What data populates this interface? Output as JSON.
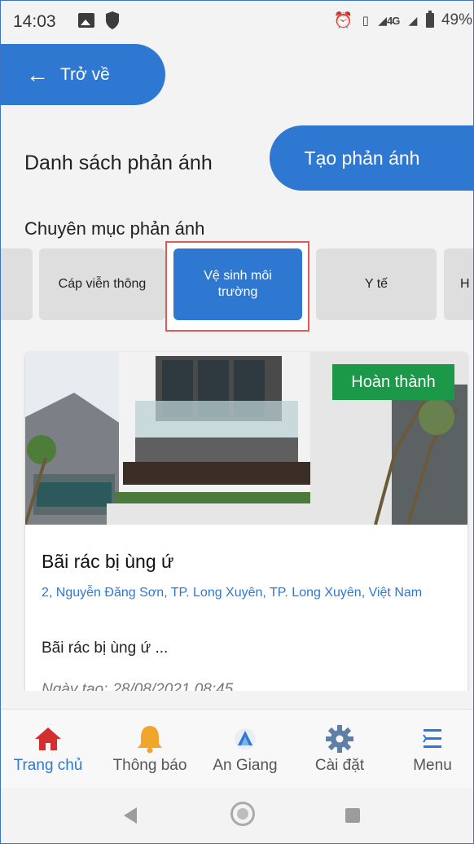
{
  "status_bar": {
    "time": "14:03",
    "right_text": "4G",
    "battery": "49%"
  },
  "back_button": {
    "label": "Trở về"
  },
  "header": {
    "title": "Danh sách phản ánh",
    "create_label": "Tạo phản ánh"
  },
  "category_section": {
    "label": "Chuyên mục phản ánh",
    "tabs": [
      {
        "label": "Cáp viễn thông"
      },
      {
        "label": "Vệ sinh môi trường"
      },
      {
        "label": "Y tế"
      },
      {
        "label": "H"
      }
    ],
    "active_index": 1
  },
  "card": {
    "status": "Hoàn thành",
    "title": "Bãi rác bị ùng ứ",
    "address": "2, Nguyễn Đăng Sơn, TP. Long Xuyên, TP. Long Xuyên, Việt Nam",
    "description": "Bãi rác bị ùng ứ ...",
    "date_label": "Ngày tạo:",
    "date_value": "28/08/2021 08:45"
  },
  "bottom_nav": {
    "items": [
      {
        "label": "Trang chủ",
        "icon": "home-icon"
      },
      {
        "label": "Thông báo",
        "icon": "bell-icon"
      },
      {
        "label": "An Giang",
        "icon": "an-giang-logo-icon"
      },
      {
        "label": "Cài đặt",
        "icon": "gear-icon"
      },
      {
        "label": "Menu",
        "icon": "menu-icon"
      }
    ],
    "active_index": 0
  },
  "colors": {
    "primary": "#2f78d2",
    "status_done": "#1b9848",
    "highlight_border": "#e05a5a",
    "home_active": "#d32f2f",
    "bell": "#f2a52b"
  }
}
